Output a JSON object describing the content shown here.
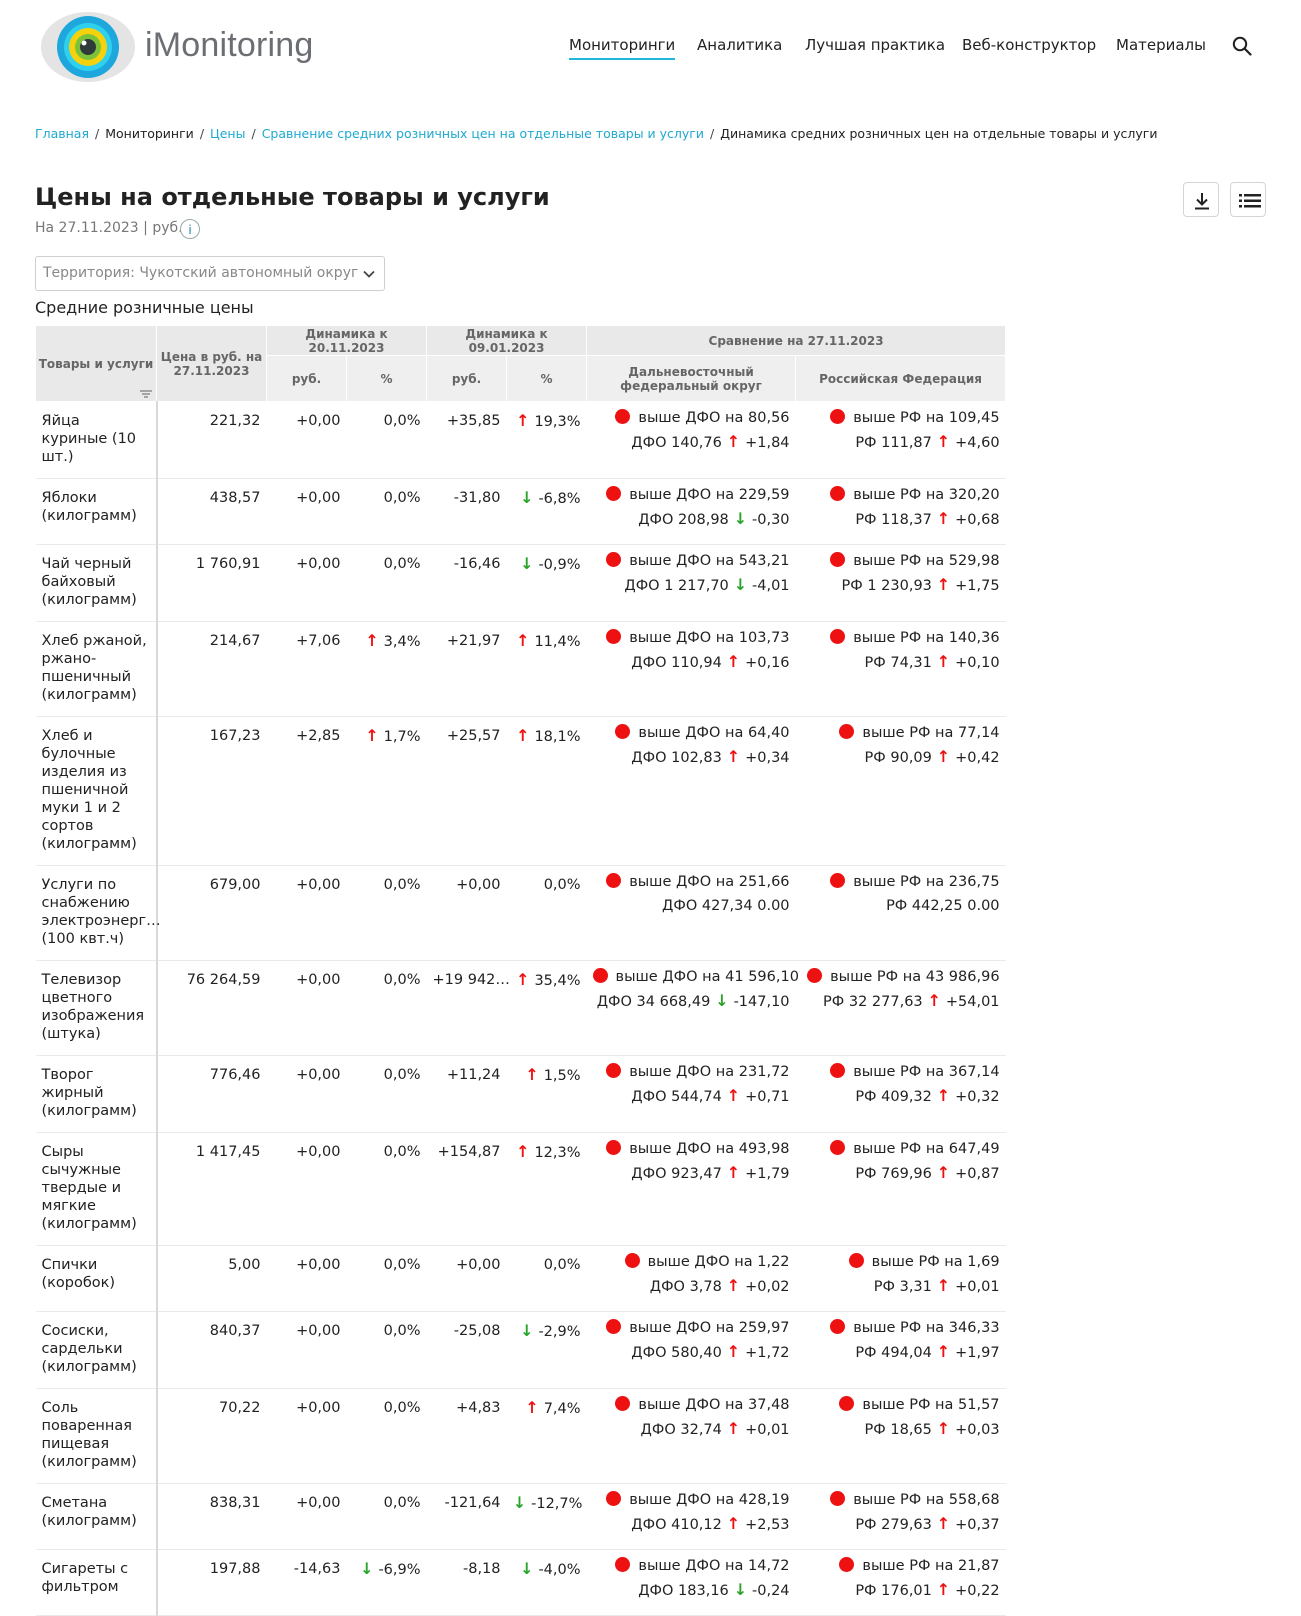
{
  "brand": {
    "name": "iMonitoring",
    "colors": {
      "accent": "#1fb6d9",
      "up": "#ee1111",
      "down": "#2aa32a"
    }
  },
  "nav": {
    "items": [
      "Мониторинги",
      "Аналитика",
      "Лучшая практика",
      "Веб-конструктор",
      "Материалы"
    ],
    "active_index": 0,
    "search_icon": "search-icon"
  },
  "breadcrumb": [
    {
      "label": "Главная",
      "link": true
    },
    {
      "label": "Мониторинги",
      "link": false
    },
    {
      "label": "Цены",
      "link": true
    },
    {
      "label": "Сравнение средних розничных цен на отдельные товары и услуги",
      "link": true
    },
    {
      "label": "Динамика средних розничных цен на отдельные товары и услуги",
      "link": false
    }
  ],
  "page": {
    "title": "Цены на отдельные товары и услуги",
    "subtitle": "На 27.11.2023 | руб.",
    "info_label": "i",
    "territory": "Территория: Чукотский автономный округ",
    "section_label": "Средние розничные цены"
  },
  "table": {
    "headers": {
      "goods": "Товары и услуги",
      "price": "Цена в руб. на 27.11.2023",
      "dyn1": "Динамика к 20.11.2023",
      "dyn2": "Динамика к 09.01.2023",
      "compare": "Сравнение на 27.11.2023",
      "rub": "руб.",
      "pct": "%",
      "dfo": "Дальневосточный федеральный округ",
      "rf": "Российская Федерация"
    },
    "rows": [
      {
        "name": "Яйца куриные (10 шт.)",
        "price": "221,32",
        "d1_rub": "+0,00",
        "d1_dir": "",
        "d1_pct": "0,0%",
        "d2_rub": "+35,85",
        "d2_dir": "up",
        "d2_pct": "19,3%",
        "dfo_cmp": "выше ДФО на 80,56",
        "dfo_val": "ДФО 140,76",
        "dfo_dir": "up",
        "dfo_chg": "+1,84",
        "rf_cmp": "выше РФ на 109,45",
        "rf_val": "РФ 111,87",
        "rf_dir": "up",
        "rf_chg": "+4,60"
      },
      {
        "name": "Яблоки (килограмм)",
        "price": "438,57",
        "d1_rub": "+0,00",
        "d1_dir": "",
        "d1_pct": "0,0%",
        "d2_rub": "-31,80",
        "d2_dir": "down",
        "d2_pct": "-6,8%",
        "dfo_cmp": "выше ДФО на 229,59",
        "dfo_val": "ДФО 208,98",
        "dfo_dir": "down",
        "dfo_chg": "-0,30",
        "rf_cmp": "выше РФ на 320,20",
        "rf_val": "РФ 118,37",
        "rf_dir": "up",
        "rf_chg": "+0,68"
      },
      {
        "name": "Чай черный байховый (килограмм)",
        "price": "1 760,91",
        "d1_rub": "+0,00",
        "d1_dir": "",
        "d1_pct": "0,0%",
        "d2_rub": "-16,46",
        "d2_dir": "down",
        "d2_pct": "-0,9%",
        "dfo_cmp": "выше ДФО на 543,21",
        "dfo_val": "ДФО 1 217,70",
        "dfo_dir": "down",
        "dfo_chg": "-4,01",
        "rf_cmp": "выше РФ на 529,98",
        "rf_val": "РФ 1 230,93",
        "rf_dir": "up",
        "rf_chg": "+1,75"
      },
      {
        "name": "Хлеб ржаной, ржано-пшеничный (килограмм)",
        "price": "214,67",
        "d1_rub": "+7,06",
        "d1_dir": "up",
        "d1_pct": "3,4%",
        "d2_rub": "+21,97",
        "d2_dir": "up",
        "d2_pct": "11,4%",
        "dfo_cmp": "выше ДФО на 103,73",
        "dfo_val": "ДФО 110,94",
        "dfo_dir": "up",
        "dfo_chg": "+0,16",
        "rf_cmp": "выше РФ на 140,36",
        "rf_val": "РФ 74,31",
        "rf_dir": "up",
        "rf_chg": "+0,10"
      },
      {
        "name": "Хлеб и булочные изделия из пшеничной муки 1 и 2 сортов (килограмм)",
        "price": "167,23",
        "d1_rub": "+2,85",
        "d1_dir": "up",
        "d1_pct": "1,7%",
        "d2_rub": "+25,57",
        "d2_dir": "up",
        "d2_pct": "18,1%",
        "dfo_cmp": "выше ДФО на 64,40",
        "dfo_val": "ДФО 102,83",
        "dfo_dir": "up",
        "dfo_chg": "+0,34",
        "rf_cmp": "выше РФ на 77,14",
        "rf_val": "РФ 90,09",
        "rf_dir": "up",
        "rf_chg": "+0,42"
      },
      {
        "name": "Услуги по снабжению электроэнерг… (100 квт.ч)",
        "price": "679,00",
        "d1_rub": "+0,00",
        "d1_dir": "",
        "d1_pct": "0,0%",
        "d2_rub": "+0,00",
        "d2_dir": "",
        "d2_pct": "0,0%",
        "dfo_cmp": "выше ДФО на 251,66",
        "dfo_val": "ДФО 427,34",
        "dfo_dir": "",
        "dfo_chg": "0.00",
        "rf_cmp": "выше РФ на 236,75",
        "rf_val": "РФ 442,25",
        "rf_dir": "",
        "rf_chg": "0.00"
      },
      {
        "name": "Телевизор цветного изображения (штука)",
        "price": "76 264,59",
        "d1_rub": "+0,00",
        "d1_dir": "",
        "d1_pct": "0,0%",
        "d2_rub": "+19 942…",
        "d2_dir": "up",
        "d2_pct": "35,4%",
        "dfo_cmp": "выше ДФО на 41 596,10",
        "dfo_val": "ДФО 34 668,49",
        "dfo_dir": "down",
        "dfo_chg": "-147,10",
        "rf_cmp": "выше РФ на 43 986,96",
        "rf_val": "РФ 32 277,63",
        "rf_dir": "up",
        "rf_chg": "+54,01"
      },
      {
        "name": "Творог жирный (килограмм)",
        "price": "776,46",
        "d1_rub": "+0,00",
        "d1_dir": "",
        "d1_pct": "0,0%",
        "d2_rub": "+11,24",
        "d2_dir": "up",
        "d2_pct": "1,5%",
        "dfo_cmp": "выше ДФО на 231,72",
        "dfo_val": "ДФО 544,74",
        "dfo_dir": "up",
        "dfo_chg": "+0,71",
        "rf_cmp": "выше РФ на 367,14",
        "rf_val": "РФ 409,32",
        "rf_dir": "up",
        "rf_chg": "+0,32"
      },
      {
        "name": "Сыры сычужные твердые и мягкие (килограмм)",
        "price": "1 417,45",
        "d1_rub": "+0,00",
        "d1_dir": "",
        "d1_pct": "0,0%",
        "d2_rub": "+154,87",
        "d2_dir": "up",
        "d2_pct": "12,3%",
        "dfo_cmp": "выше ДФО на 493,98",
        "dfo_val": "ДФО 923,47",
        "dfo_dir": "up",
        "dfo_chg": "+1,79",
        "rf_cmp": "выше РФ на 647,49",
        "rf_val": "РФ 769,96",
        "rf_dir": "up",
        "rf_chg": "+0,87"
      },
      {
        "name": "Спички (коробок)",
        "price": "5,00",
        "d1_rub": "+0,00",
        "d1_dir": "",
        "d1_pct": "0,0%",
        "d2_rub": "+0,00",
        "d2_dir": "",
        "d2_pct": "0,0%",
        "dfo_cmp": "выше ДФО на 1,22",
        "dfo_val": "ДФО 3,78",
        "dfo_dir": "up",
        "dfo_chg": "+0,02",
        "rf_cmp": "выше РФ на 1,69",
        "rf_val": "РФ 3,31",
        "rf_dir": "up",
        "rf_chg": "+0,01"
      },
      {
        "name": "Сосиски, сардельки (килограмм)",
        "price": "840,37",
        "d1_rub": "+0,00",
        "d1_dir": "",
        "d1_pct": "0,0%",
        "d2_rub": "-25,08",
        "d2_dir": "down",
        "d2_pct": "-2,9%",
        "dfo_cmp": "выше ДФО на 259,97",
        "dfo_val": "ДФО 580,40",
        "dfo_dir": "up",
        "dfo_chg": "+1,72",
        "rf_cmp": "выше РФ на 346,33",
        "rf_val": "РФ 494,04",
        "rf_dir": "up",
        "rf_chg": "+1,97"
      },
      {
        "name": "Соль поваренная пищевая (килограмм)",
        "price": "70,22",
        "d1_rub": "+0,00",
        "d1_dir": "",
        "d1_pct": "0,0%",
        "d2_rub": "+4,83",
        "d2_dir": "up",
        "d2_pct": "7,4%",
        "dfo_cmp": "выше ДФО на 37,48",
        "dfo_val": "ДФО 32,74",
        "dfo_dir": "up",
        "dfo_chg": "+0,01",
        "rf_cmp": "выше РФ на 51,57",
        "rf_val": "РФ 18,65",
        "rf_dir": "up",
        "rf_chg": "+0,03"
      },
      {
        "name": "Сметана (килограмм)",
        "price": "838,31",
        "d1_rub": "+0,00",
        "d1_dir": "",
        "d1_pct": "0,0%",
        "d2_rub": "-121,64",
        "d2_dir": "down",
        "d2_pct": "-12,7%",
        "dfo_cmp": "выше ДФО на 428,19",
        "dfo_val": "ДФО 410,12",
        "dfo_dir": "up",
        "dfo_chg": "+2,53",
        "rf_cmp": "выше РФ на 558,68",
        "rf_val": "РФ 279,63",
        "rf_dir": "up",
        "rf_chg": "+0,37"
      },
      {
        "name": "Сигареты с фильтром",
        "price": "197,88",
        "d1_rub": "-14,63",
        "d1_dir": "down",
        "d1_pct": "-6,9%",
        "d2_rub": "-8,18",
        "d2_dir": "down",
        "d2_pct": "-4,0%",
        "dfo_cmp": "выше ДФО на 14,72",
        "dfo_val": "ДФО 183,16",
        "dfo_dir": "down",
        "dfo_chg": "-0,24",
        "rf_cmp": "выше РФ на 21,87",
        "rf_val": "РФ 176,01",
        "rf_dir": "up",
        "rf_chg": "+0,22"
      }
    ]
  }
}
